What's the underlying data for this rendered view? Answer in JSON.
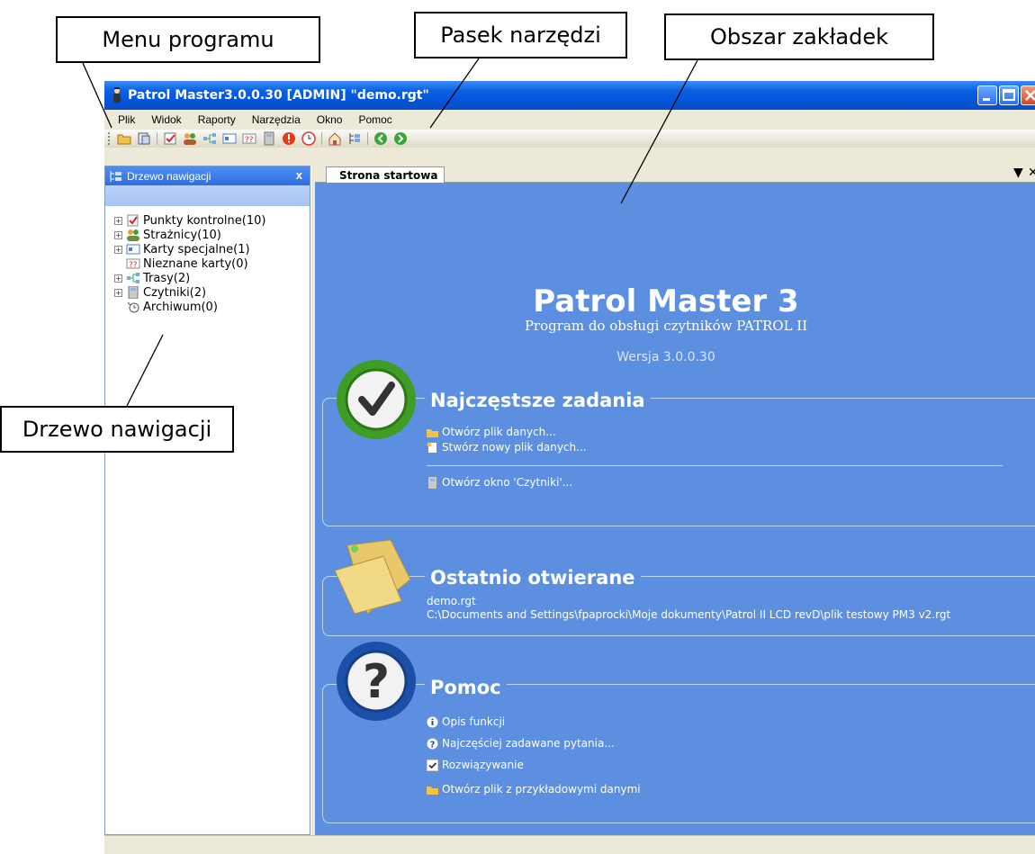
{
  "callouts": {
    "menu": "Menu programu",
    "toolbar": "Pasek narzędzi",
    "tabs_area": "Obszar zakładek",
    "nav_tree": "Drzewo nawigacji"
  },
  "window": {
    "title": "Patrol Master3.0.0.30  [ADMIN] \"demo.rgt\""
  },
  "menu": {
    "items": [
      "Plik",
      "Widok",
      "Raporty",
      "Narzędzia",
      "Okno",
      "Pomoc"
    ]
  },
  "toolbar": {
    "icons": [
      "open-folder-icon",
      "save-icon",
      "checkpoint-icon",
      "guards-icon",
      "routes-icon",
      "special-cards-icon",
      "unknown-cards-icon",
      "reader-icon",
      "alert-icon",
      "clock-icon",
      "home-icon",
      "tree-icon",
      "back-icon",
      "forward-icon"
    ]
  },
  "nav_panel": {
    "header": "Drzewo nawigacji",
    "close": "x",
    "items": [
      {
        "label": "Punkty kontrolne(10)",
        "expandable": true
      },
      {
        "label": "Strażnicy(10)",
        "expandable": true
      },
      {
        "label": "Karty specjalne(1)",
        "expandable": true
      },
      {
        "label": "Nieznane karty(0)",
        "expandable": false
      },
      {
        "label": "Trasy(2)",
        "expandable": true
      },
      {
        "label": "Czytniki(2)",
        "expandable": true
      },
      {
        "label": "Archiwum(0)",
        "expandable": false
      }
    ]
  },
  "tabs": {
    "active": "Strona startowa",
    "menu_glyph": "▼",
    "close_glyph": "✕"
  },
  "start_page": {
    "title": "Patrol Master 3",
    "subtitle": "Program  do obsługi czytników PATROL II",
    "version": "Wersja  3.0.0.30",
    "sections": {
      "tasks": {
        "title": "Najczęstsze zadania",
        "links": [
          "Otwórz plik danych...",
          "Stwórz nowy plik danych...",
          "Otwórz okno 'Czytniki'..."
        ]
      },
      "recent": {
        "title": "Ostatnio otwierane",
        "items": [
          "demo.rgt",
          "C:\\Documents and Settings\\fpaprocki\\Moje dokumenty\\Patrol II LCD revD\\plik testowy PM3 v2.rgt"
        ]
      },
      "help": {
        "title": "Pomoc",
        "links": [
          "Opis funkcji",
          "Najczęściej zadawane pytania...",
          "Rozwiązywanie",
          "Otwórz plik z przykładowymi danymi"
        ]
      }
    }
  },
  "colors": {
    "start_page_bg": "#5c8fe0",
    "title_bar": "#0454d8"
  }
}
